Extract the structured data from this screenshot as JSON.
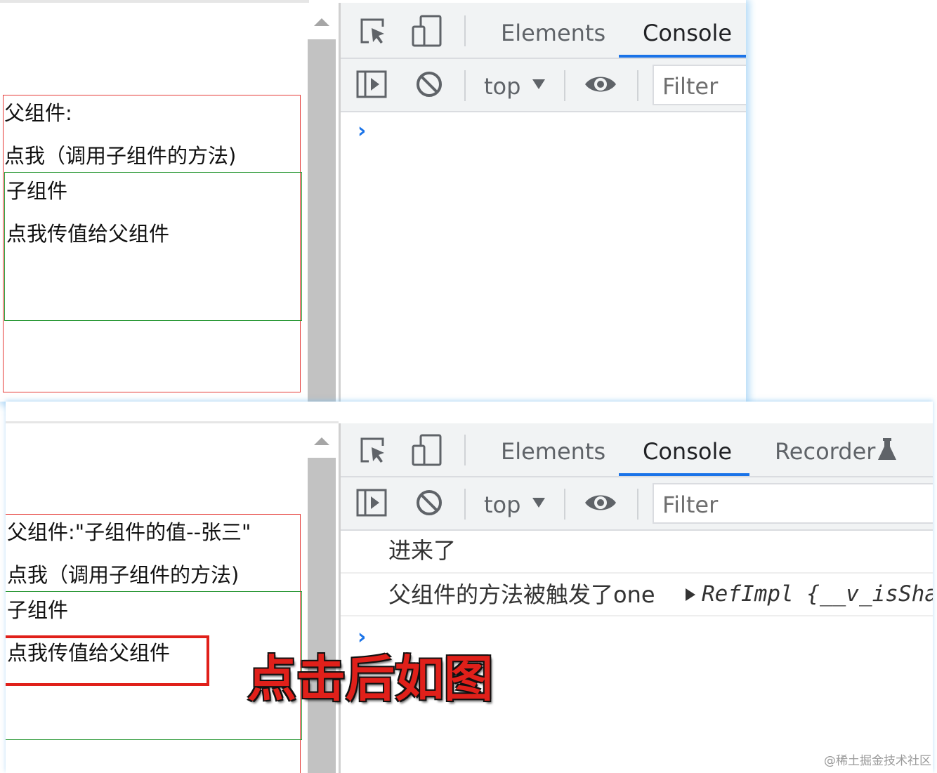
{
  "before": {
    "page": {
      "parent_text": "父组件:",
      "parent_button": "点我（调用子组件的方法)",
      "child_title": "子组件",
      "child_button": "点我传值给父组件"
    },
    "devtools": {
      "tabs": [
        "Elements",
        "Console"
      ],
      "active_tab": "Console",
      "context": "top",
      "filter_placeholder": "Filter",
      "prompt": "›"
    }
  },
  "after": {
    "page": {
      "parent_text": "父组件:\"子组件的值--张三\"",
      "parent_button": "点我（调用子组件的方法)",
      "child_title": "子组件",
      "child_button": "点我传值给父组件"
    },
    "devtools": {
      "tabs": [
        "Elements",
        "Console",
        "Recorder"
      ],
      "active_tab": "Console",
      "context": "top",
      "filter_placeholder": "Filter",
      "logs": [
        {
          "text": "进来了"
        },
        {
          "text": "父组件的方法被触发了one",
          "object": "RefImpl {__v_isSha"
        }
      ],
      "prompt": "›"
    }
  },
  "annotation": {
    "caption": "点击后如图"
  },
  "watermark": "@稀土掘金技术社区",
  "colors": {
    "parent_border": "#e53935",
    "child_border": "#2e9a3a",
    "highlight_border": "#e0201a",
    "tab_underline": "#1a73e8"
  }
}
